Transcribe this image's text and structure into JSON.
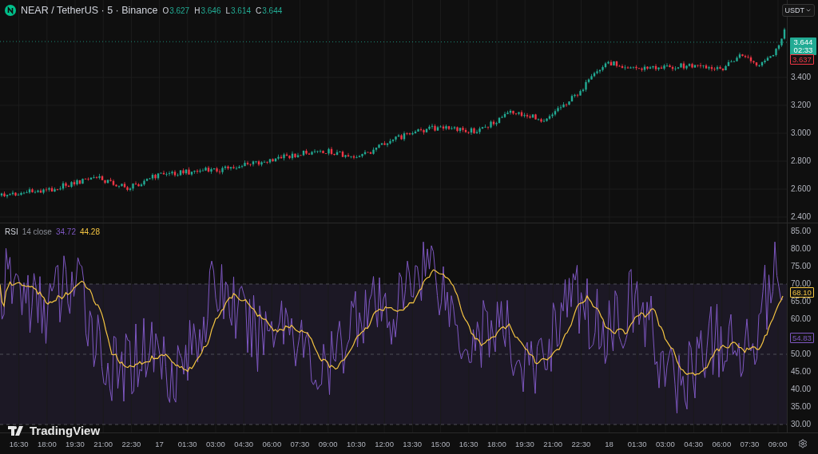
{
  "header": {
    "symbol": "NEAR / TetherUS · 5 · Binance",
    "ohlc": [
      {
        "label": "O",
        "value": "3.627"
      },
      {
        "label": "H",
        "value": "3.646"
      },
      {
        "label": "L",
        "value": "3.614"
      },
      {
        "label": "C",
        "value": "3.644"
      }
    ]
  },
  "currency_button": {
    "label": "USDT"
  },
  "price_axis": {
    "last_price": "3.644",
    "countdown": "02:33",
    "previous_close": "3.637",
    "ticks": [
      "3.400",
      "3.200",
      "3.000",
      "2.800",
      "2.600",
      "2.400"
    ]
  },
  "rsi": {
    "name": "RSI",
    "params": "14 close",
    "value": "34.72",
    "ma_value": "44.28",
    "ma_tag": "68.10",
    "value_tag": "54.83",
    "ticks": [
      "85.00",
      "80.00",
      "75.00",
      "70.00",
      "65.00",
      "60.00",
      "50.00",
      "45.00",
      "40.00",
      "35.00",
      "30.00"
    ]
  },
  "time_axis": {
    "ticks": [
      "16:30",
      "18:00",
      "19:30",
      "21:00",
      "22:30",
      "17",
      "01:30",
      "03:00",
      "04:30",
      "06:00",
      "07:30",
      "09:00",
      "10:30",
      "12:00",
      "13:30",
      "15:00",
      "16:30",
      "18:00",
      "19:30",
      "21:00",
      "22:30",
      "18",
      "01:30",
      "03:00",
      "04:30",
      "06:00",
      "07:30",
      "09:00"
    ]
  },
  "brand": "TradingView"
}
